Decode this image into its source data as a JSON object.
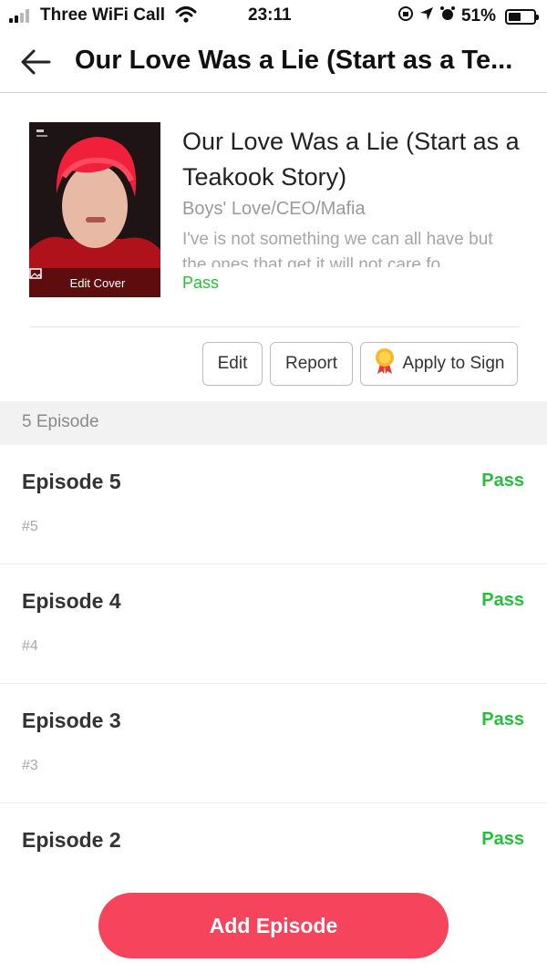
{
  "status_bar": {
    "carrier": "Three WiFi Call",
    "time": "23:11",
    "battery": "51%",
    "battery_level": 0.51
  },
  "nav": {
    "back_icon": "back-arrow-icon",
    "title": "Our Love Was a Lie (Start as a Te..."
  },
  "book": {
    "cover_label": "Edit Cover",
    "title": "Our Love Was a Lie (Start as a Teakook Story)",
    "genre": "Boys' Love/CEO/Mafia",
    "description": "I've is not something we can all have but the ones that get it will not care fo...",
    "status": "Pass"
  },
  "actions": {
    "edit_label": "Edit",
    "report_label": "Report",
    "sign_label": "Apply to Sign"
  },
  "episodes": {
    "count_label": "5 Episode",
    "items": [
      {
        "name": "Episode 5",
        "number": "#5",
        "status": "Pass"
      },
      {
        "name": "Episode 4",
        "number": "#4",
        "status": "Pass"
      },
      {
        "name": "Episode 3",
        "number": "#3",
        "status": "Pass"
      },
      {
        "name": "Episode 2",
        "number": "",
        "status": "Pass"
      }
    ]
  },
  "add_episode_label": "Add Episode",
  "colors": {
    "accent": "#f5445b",
    "pass": "#25c03a"
  }
}
